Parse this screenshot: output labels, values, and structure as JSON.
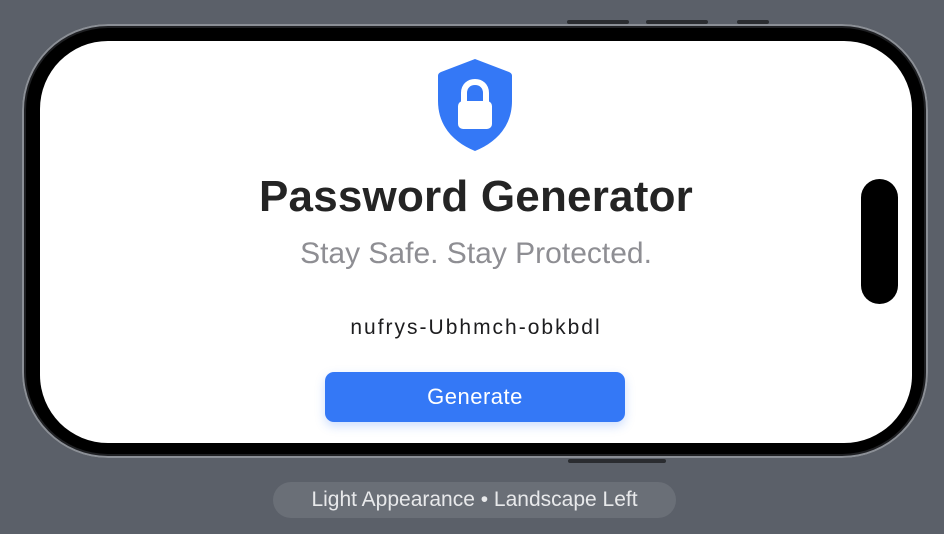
{
  "app": {
    "title": "Password Generator",
    "subtitle": "Stay Safe. Stay Protected.",
    "generated_password": "nufrys-Ubhmch-obkbdl",
    "generate_button_label": "Generate",
    "icon": "shield-lock-icon"
  },
  "simulator": {
    "appearance_label": "Light Appearance • Landscape Left"
  },
  "colors": {
    "accent": "#3478f6",
    "title_text": "#242424",
    "subtitle_text": "#8e8e93",
    "screen_background": "#ffffff",
    "desktop_background": "#5b6069"
  }
}
